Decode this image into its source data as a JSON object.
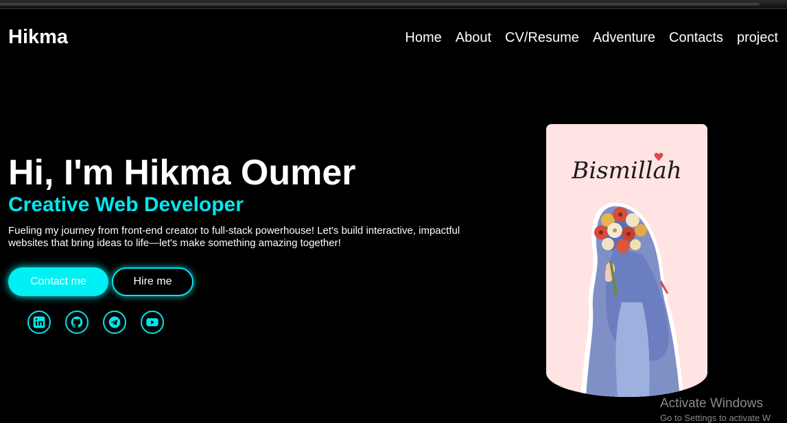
{
  "brand": {
    "name": "Hikma"
  },
  "nav": {
    "items": [
      "Home",
      "About",
      "CV/Resume",
      "Adventure",
      "Contacts",
      "project"
    ]
  },
  "hero": {
    "title": "Hi, I'm Hikma Oumer",
    "subtitle": "Creative Web Developer",
    "description": "Fueling my journey from front-end creator to full-stack powerhouse! Let's build interactive, impactful websites that bring ideas to life—let's make something amazing together!",
    "contact_label": "Contact me",
    "hire_label": "Hire me"
  },
  "social": [
    "linkedin-icon",
    "github-icon",
    "telegram-icon",
    "youtube-icon"
  ],
  "portrait": {
    "caption": "Bismillah"
  },
  "watermark": {
    "title": "Activate Windows",
    "subtitle": "Go to Settings to activate W"
  },
  "colors": {
    "accent": "#00e8ef",
    "background": "#000000",
    "portrait_bg": "#ffe4e3"
  }
}
